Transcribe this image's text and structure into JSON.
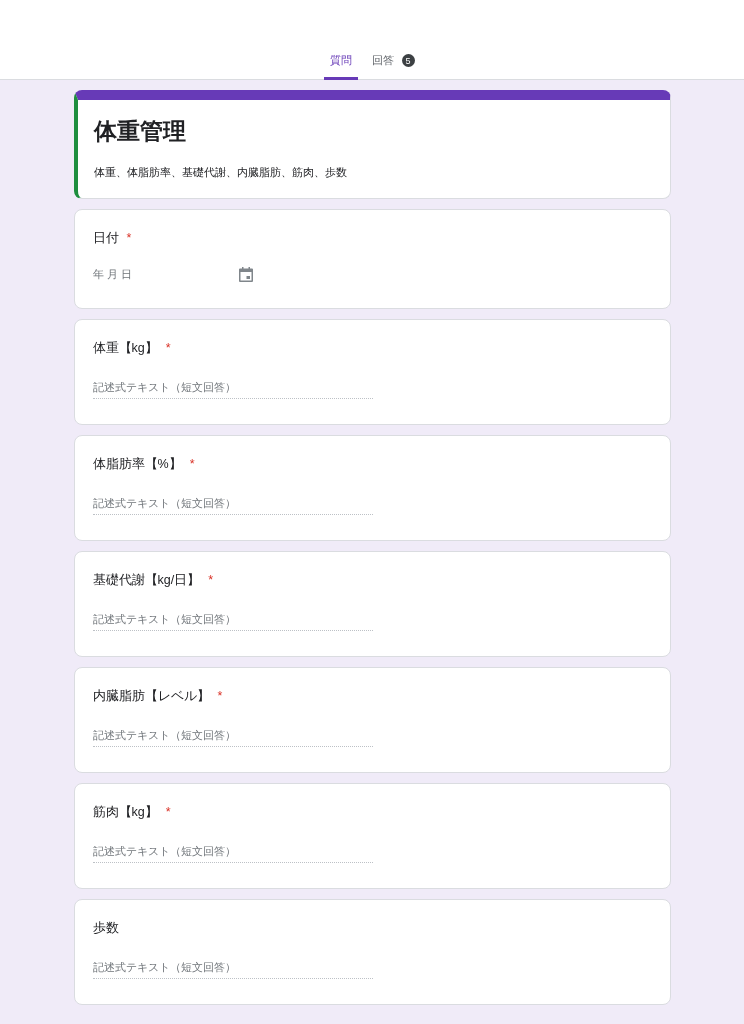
{
  "tabs": [
    {
      "label": "質問",
      "selected": true
    },
    {
      "label": "回答",
      "selected": false,
      "badge": "5"
    }
  ],
  "form": {
    "title": "体重管理",
    "description": "体重、体脂肪率、基礎代謝、内臓脂肪、筋肉、歩数"
  },
  "questions": [
    {
      "kind": "date",
      "label": "日付",
      "required_mark": "*",
      "placeholder": "年 月 日"
    },
    {
      "kind": "text",
      "label": "体重【kg】",
      "required_mark": "*",
      "placeholder": "記述式テキスト（短文回答）"
    },
    {
      "kind": "text",
      "label": "体脂肪率【%】",
      "required_mark": "*",
      "placeholder": "記述式テキスト（短文回答）"
    },
    {
      "kind": "text",
      "label": "基礎代謝【kg/日】",
      "required_mark": "*",
      "placeholder": "記述式テキスト（短文回答）"
    },
    {
      "kind": "text",
      "label": "内臓脂肪【レベル】",
      "required_mark": "*",
      "placeholder": "記述式テキスト（短文回答）"
    },
    {
      "kind": "text",
      "label": "筋肉【kg】",
      "required_mark": "*",
      "placeholder": "記述式テキスト（短文回答）"
    },
    {
      "kind": "text",
      "label": "歩数",
      "placeholder": "記述式テキスト（短文回答）"
    }
  ]
}
